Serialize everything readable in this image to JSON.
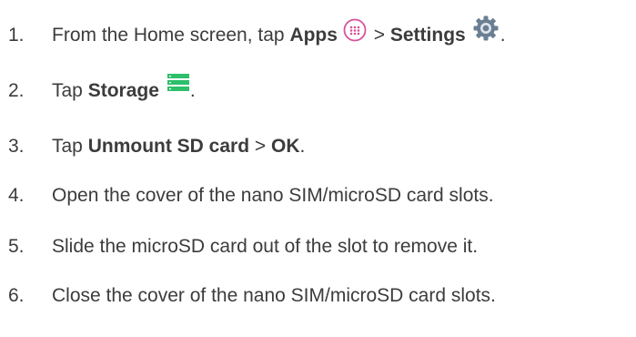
{
  "steps": [
    {
      "number": "1.",
      "parts": {
        "t1": "From the Home screen, tap ",
        "b1": "Apps",
        "t2": " > ",
        "b2": "Settings",
        "t3": "."
      },
      "icons": [
        "apps-icon",
        "settings-gear-icon"
      ]
    },
    {
      "number": "2.",
      "parts": {
        "t1": "Tap ",
        "b1": "Storage",
        "t2": "."
      },
      "icons": [
        "storage-icon"
      ]
    },
    {
      "number": "3.",
      "parts": {
        "t1": "Tap ",
        "b1": "Unmount SD card",
        "t2": " > ",
        "b2": "OK",
        "t3": "."
      }
    },
    {
      "number": "4.",
      "text": "Open the cover of the nano SIM/microSD card slots."
    },
    {
      "number": "5.",
      "text": "Slide the microSD card out of the slot to remove it."
    },
    {
      "number": "6.",
      "text": "Close the cover of the nano SIM/microSD card slots."
    }
  ],
  "colors": {
    "text": "#3c3c3c",
    "apps_icon": "#d8529c",
    "settings_icon": "#6b7f93",
    "storage_icon": "#2dbf6a"
  }
}
